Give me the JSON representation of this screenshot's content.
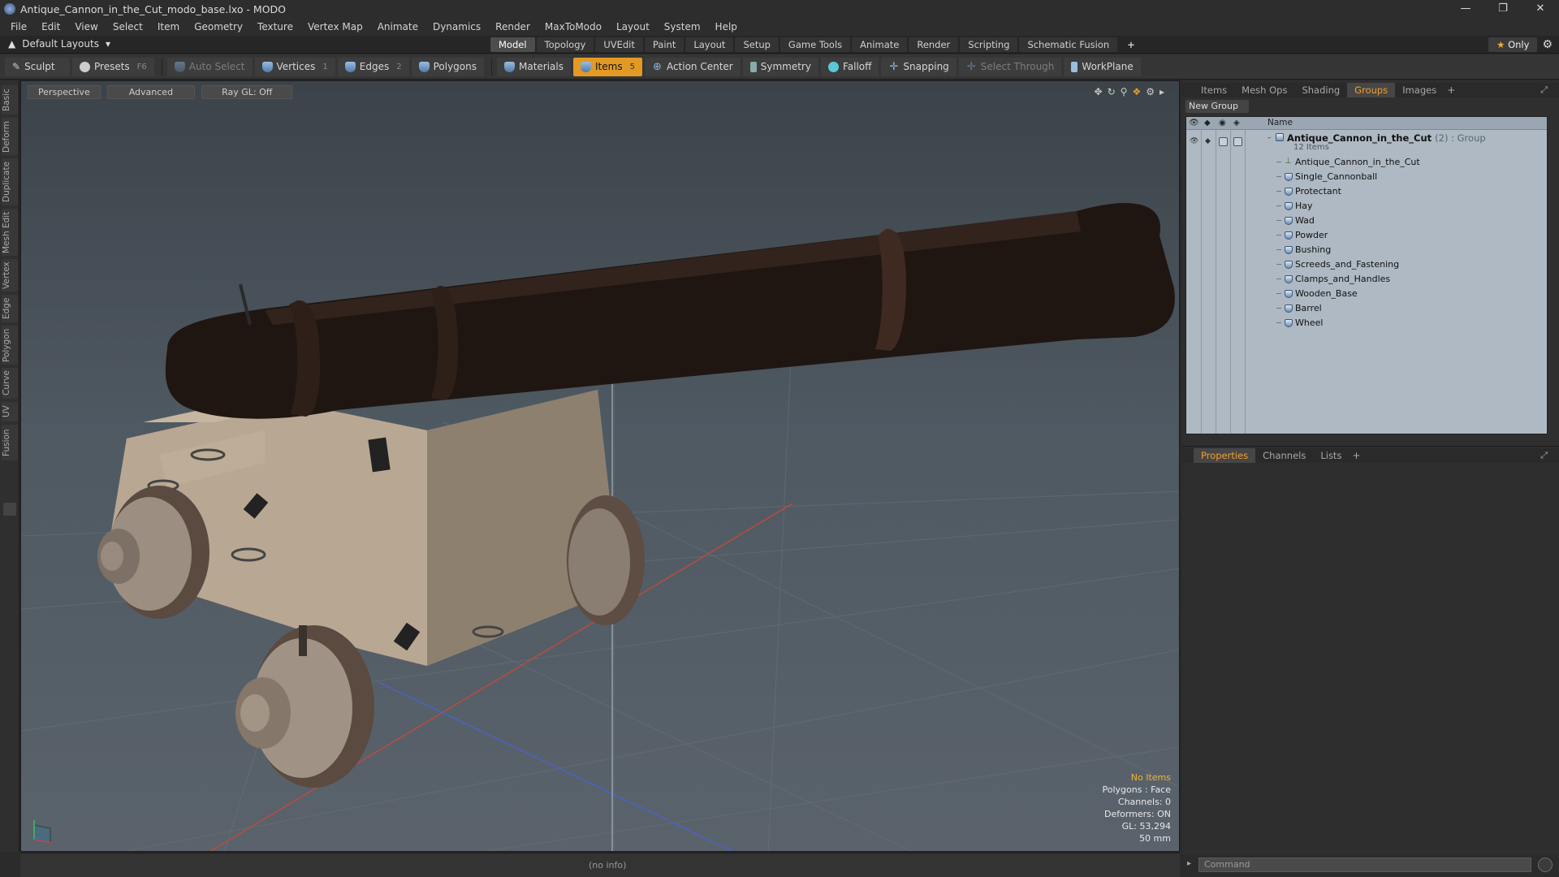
{
  "window": {
    "title": "Antique_Cannon_in_the_Cut_modo_base.lxo - MODO"
  },
  "menu": [
    "File",
    "Edit",
    "View",
    "Select",
    "Item",
    "Geometry",
    "Texture",
    "Vertex Map",
    "Animate",
    "Dynamics",
    "Render",
    "MaxToModo",
    "Layout",
    "System",
    "Help"
  ],
  "layoutbar": {
    "layout_name": "Default Layouts",
    "tabs": [
      "Model",
      "Topology",
      "UVEdit",
      "Paint",
      "Layout",
      "Setup",
      "Game Tools",
      "Animate",
      "Render",
      "Scripting",
      "Schematic Fusion"
    ],
    "active_tab": "Model",
    "only_label": "Only"
  },
  "toolbar": {
    "sculpt": "Sculpt",
    "presets": "Presets",
    "presets_key": "F6",
    "auto_select": "Auto Select",
    "vertices": "Vertices",
    "vertices_key": "1",
    "edges": "Edges",
    "edges_key": "2",
    "polygons": "Polygons",
    "materials": "Materials",
    "items": "Items",
    "items_key": "5",
    "action_center": "Action Center",
    "symmetry": "Symmetry",
    "falloff": "Falloff",
    "snapping": "Snapping",
    "select_through": "Select Through",
    "workplane": "WorkPlane"
  },
  "left_tabs": [
    "Basic",
    "Deform",
    "Duplicate",
    "Mesh Edit",
    "Vertex",
    "Edge",
    "Polygon",
    "Curve",
    "UV",
    "Fusion"
  ],
  "viewport": {
    "view_mode": "Perspective",
    "shading": "Advanced",
    "raygl": "Ray GL: Off",
    "stats": {
      "no_items": "No Items",
      "polygons": "Polygons : Face",
      "channels": "Channels: 0",
      "deformers": "Deformers: ON",
      "gl": "GL: 53,294",
      "focal": "50 mm"
    }
  },
  "infobar": {
    "text": "(no info)"
  },
  "right_panel": {
    "top_tabs": [
      "Items",
      "Mesh Ops",
      "Shading",
      "Groups",
      "Images"
    ],
    "active_top_tab": "Groups",
    "new_group": "New Group",
    "column_name": "Name",
    "group": {
      "name": "Antique_Cannon_in_the_Cut",
      "meta": "(2) : Group",
      "count": "12 Items"
    },
    "items": [
      {
        "label": "Antique_Cannon_in_the_Cut",
        "icon": "locator-icon"
      },
      {
        "label": "Single_Cannonball",
        "icon": "mesh-icon"
      },
      {
        "label": "Protectant",
        "icon": "mesh-icon"
      },
      {
        "label": "Hay",
        "icon": "mesh-icon"
      },
      {
        "label": "Wad",
        "icon": "mesh-icon"
      },
      {
        "label": "Powder",
        "icon": "mesh-icon"
      },
      {
        "label": "Bushing",
        "icon": "mesh-icon"
      },
      {
        "label": "Screeds_and_Fastening",
        "icon": "mesh-icon"
      },
      {
        "label": "Clamps_and_Handles",
        "icon": "mesh-icon"
      },
      {
        "label": "Wooden_Base",
        "icon": "mesh-icon"
      },
      {
        "label": "Barrel",
        "icon": "mesh-icon"
      },
      {
        "label": "Wheel",
        "icon": "mesh-icon"
      }
    ],
    "bottom_tabs": [
      "Properties",
      "Channels",
      "Lists"
    ],
    "active_bottom_tab": "Properties",
    "command_placeholder": "Command"
  },
  "colors": {
    "accent": "#e29a25",
    "active_tab_text": "#f0a030",
    "list_bg": "#aeb9c3"
  }
}
